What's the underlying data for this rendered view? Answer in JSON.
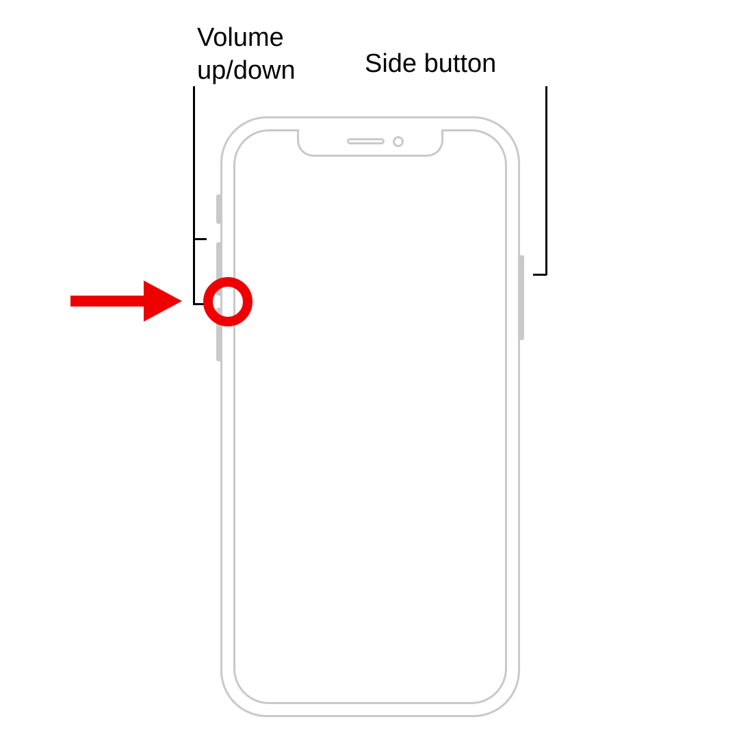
{
  "labels": {
    "volume": "Volume up/down",
    "side": "Side button"
  },
  "diagram": {
    "device": "iPhone (Face ID style)",
    "highlighted_element": "volume-buttons-area",
    "callouts": [
      "volume up/down buttons",
      "side button"
    ]
  },
  "colors": {
    "outline": "#c9c9c9",
    "highlight": "#ef0000",
    "text": "#000000"
  }
}
